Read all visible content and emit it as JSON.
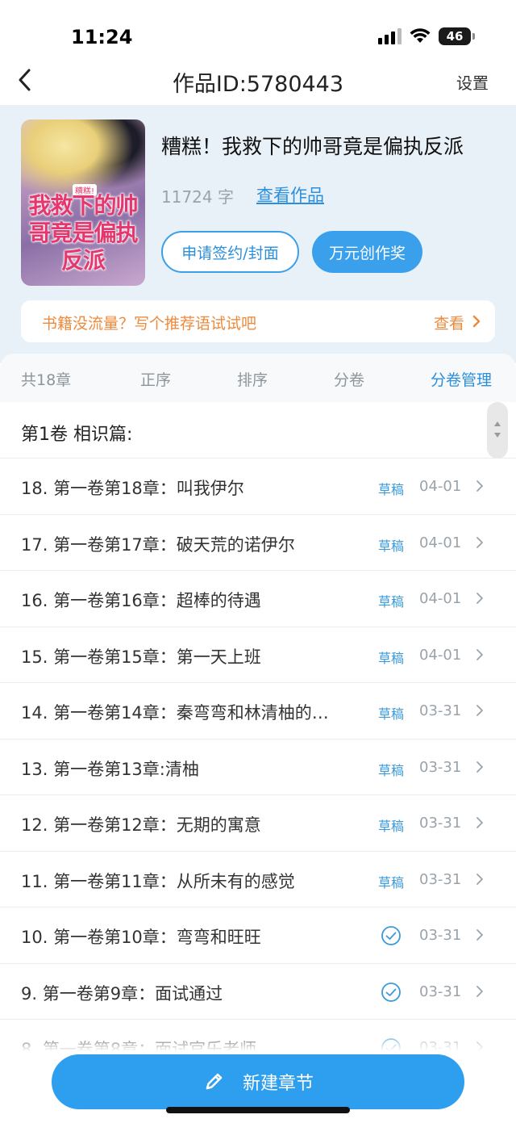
{
  "status_bar": {
    "time": "11:24",
    "battery": "46"
  },
  "nav": {
    "title": "作品ID:5780443",
    "settings": "设置"
  },
  "book": {
    "cover_small_text": "糟糕!",
    "cover_title": "我救下的帅哥竟是偏执反派",
    "title": "糟糕！我救下的帅哥竟是偏执反派",
    "word_count": "11724 字",
    "view_work": "查看作品",
    "sign_button": "申请签约/封面",
    "award_button": "万元创作奖"
  },
  "promo": {
    "text": "书籍没流量？写个推荐语试试吧",
    "link": "查看"
  },
  "tabs": {
    "total": "共18章",
    "order_asc": "正序",
    "sort": "排序",
    "volumes": "分卷",
    "volume_manage": "分卷管理"
  },
  "volume_title": "第1卷 相识篇:",
  "chapters": [
    {
      "title": "18. 第一卷第18章：叫我伊尔",
      "status": "草稿",
      "date": "04-01"
    },
    {
      "title": "17. 第一卷第17章：破天荒的诺伊尔",
      "status": "草稿",
      "date": "04-01"
    },
    {
      "title": "16. 第一卷第16章：超棒的待遇",
      "status": "草稿",
      "date": "04-01"
    },
    {
      "title": "15. 第一卷第15章：第一天上班",
      "status": "草稿",
      "date": "04-01"
    },
    {
      "title": "14. 第一卷第14章：秦弯弯和林清柚的…",
      "status": "草稿",
      "date": "03-31"
    },
    {
      "title": "13. 第一卷第13章:清柚",
      "status": "草稿",
      "date": "03-31"
    },
    {
      "title": "12. 第一卷第12章：无期的寓意",
      "status": "草稿",
      "date": "03-31"
    },
    {
      "title": "11. 第一卷第11章：从所未有的感觉",
      "status": "草稿",
      "date": "03-31"
    },
    {
      "title": "10. 第一卷第10章：弯弯和旺旺",
      "status": "published",
      "date": "03-31"
    },
    {
      "title": "9. 第一卷第9章：面试通过",
      "status": "published",
      "date": "03-31"
    },
    {
      "title": "8. 第一卷第8章：面试官乐老师",
      "status": "published",
      "date": "03-31"
    }
  ],
  "new_chapter_button": "新建章节",
  "colors": {
    "accent": "#2e9eef",
    "promo": "#ee8a3c",
    "header_bg": "#e9f1f8"
  }
}
